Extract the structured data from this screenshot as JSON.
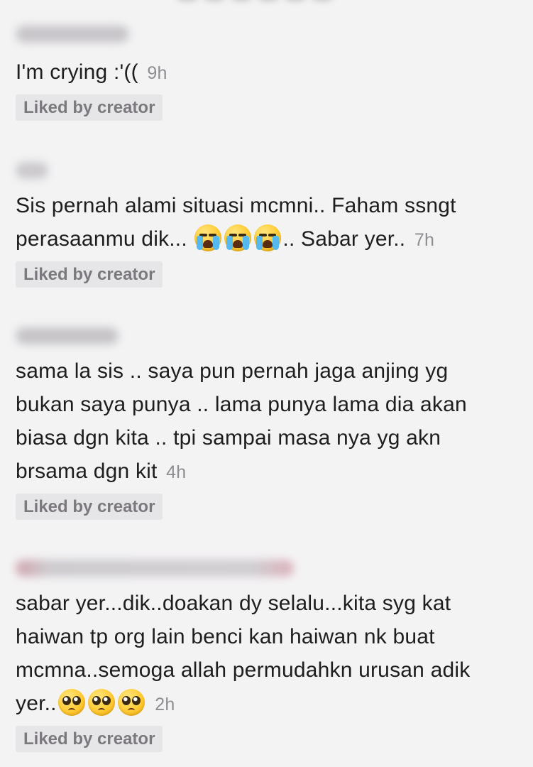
{
  "comments": [
    {
      "text": "I'm crying :'((",
      "segments": [
        "I'm crying :'(("
      ],
      "emojis": [],
      "time": "9h",
      "badge": "Liked by creator"
    },
    {
      "text": "Sis pernah alami situasi mcmni.. Faham ssngt perasaanmu dik... 😭😭😭.. Sabar yer..",
      "segments": [
        "Sis pernah alami situasi mcmni.. Faham ssngt perasaanmu dik...",
        ".. Sabar yer.."
      ],
      "emojis": [
        "loudly-crying-face-icon",
        "loudly-crying-face-icon",
        "loudly-crying-face-icon"
      ],
      "time": "7h",
      "badge": "Liked by creator"
    },
    {
      "text": "sama la sis .. saya pun pernah jaga anjing yg bukan saya punya .. lama punya lama dia akan biasa dgn kita .. tpi sampai masa nya yg akn brsama dgn kit",
      "segments": [
        "sama la sis .. saya pun pernah jaga anjing yg bukan saya punya .. lama punya lama dia akan biasa dgn kita .. tpi sampai masa nya yg akn brsama dgn kit"
      ],
      "emojis": [],
      "time": "4h",
      "badge": "Liked by creator"
    },
    {
      "text": "sabar yer...dik..doakan dy selalu...kita syg kat haiwan tp org lain benci kan haiwan nk buat mcmna..semoga allah permudahkn urusan adik yer..🥺🥺🥺",
      "segments": [
        "sabar yer...dik..doakan dy selalu...kita syg kat haiwan tp org lain benci kan haiwan nk buat mcmna..semoga allah permudahkn urusan adik yer.."
      ],
      "emojis": [
        "pleading-face-icon",
        "pleading-face-icon",
        "pleading-face-icon"
      ],
      "time": "2h",
      "badge": "Liked by creator"
    }
  ],
  "colors": {
    "background": "#f4f3f4",
    "text": "#1e1e1e",
    "timestamp": "#8f8d92",
    "badge_bg": "#e6e5e7",
    "badge_text": "#7b797e"
  }
}
